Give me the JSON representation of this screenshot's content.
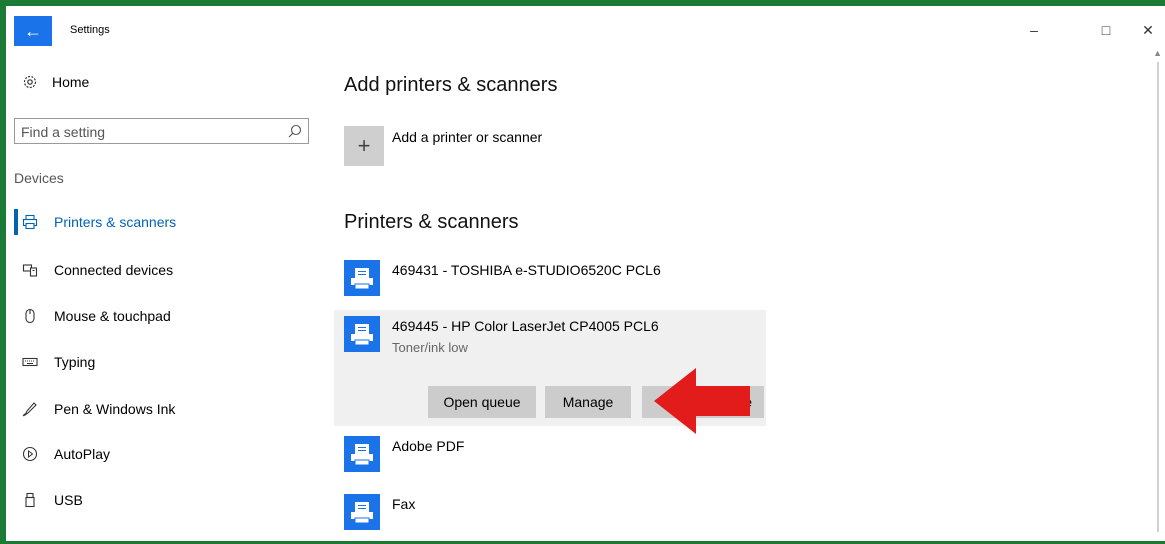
{
  "window": {
    "title": "Settings",
    "back_icon": "←",
    "minimize_glyph": "–",
    "maximize_glyph": "□",
    "close_glyph": "✕"
  },
  "sidebar": {
    "home_label": "Home",
    "search_placeholder": "Find a setting",
    "section_label": "Devices",
    "items": [
      {
        "label": "Printers & scanners",
        "icon": "printer-icon",
        "active": true
      },
      {
        "label": "Connected devices",
        "icon": "connected-devices-icon",
        "active": false
      },
      {
        "label": "Mouse & touchpad",
        "icon": "mouse-icon",
        "active": false
      },
      {
        "label": "Typing",
        "icon": "keyboard-icon",
        "active": false
      },
      {
        "label": "Pen & Windows Ink",
        "icon": "pen-icon",
        "active": false
      },
      {
        "label": "AutoPlay",
        "icon": "autoplay-icon",
        "active": false
      },
      {
        "label": "USB",
        "icon": "usb-icon",
        "active": false
      }
    ]
  },
  "main": {
    "add_heading": "Add printers & scanners",
    "add_button_glyph": "+",
    "add_label": "Add a printer or scanner",
    "list_heading": "Printers & scanners",
    "printers": [
      {
        "name": "469431 - TOSHIBA e-STUDIO6520C PCL6",
        "status": ""
      },
      {
        "name": "469445 - HP Color LaserJet CP4005 PCL6",
        "status": "Toner/ink low",
        "buttons": [
          "Open queue",
          "Manage",
          "vice"
        ]
      },
      {
        "name": "Adobe PDF",
        "status": ""
      },
      {
        "name": "Fax",
        "status": ""
      }
    ]
  },
  "colors": {
    "accent": "#0063b1",
    "printer_icon": "#1a73e8",
    "frame": "#1b7a36",
    "arrow": "#e21b1b"
  }
}
